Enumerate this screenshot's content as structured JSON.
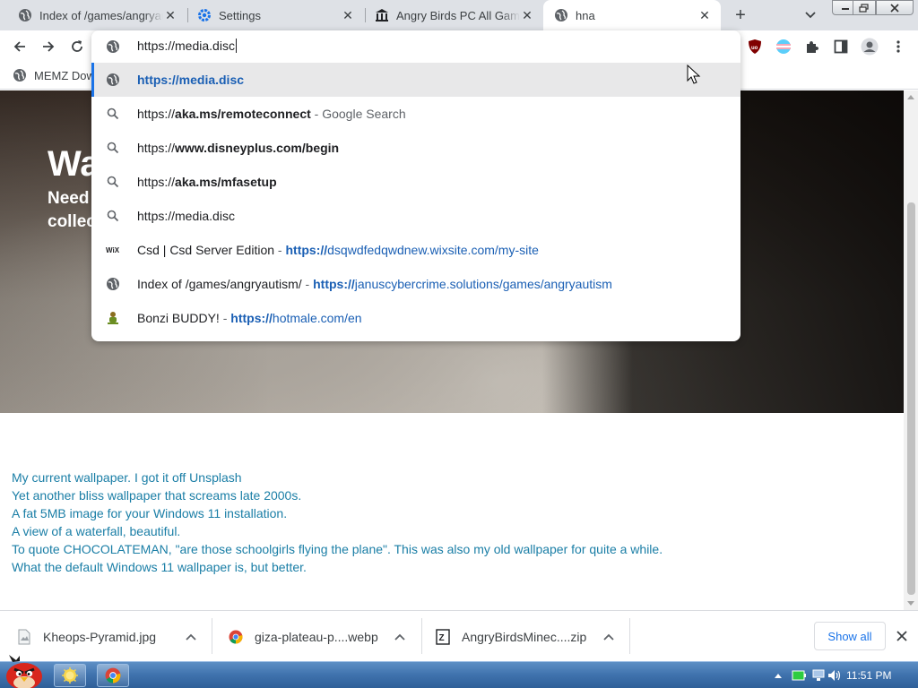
{
  "tabs": [
    {
      "title": "Index of /games/angryautism/",
      "icon": "globe-icon",
      "active": false
    },
    {
      "title": "Settings",
      "icon": "gear-icon",
      "active": false
    },
    {
      "title": "Angry Birds PC All Games",
      "icon": "museum-icon",
      "active": false
    },
    {
      "title": "hna",
      "icon": "globe-icon",
      "active": true
    }
  ],
  "toolbar": {
    "back_icon": "arrow-left-icon",
    "forward_icon": "arrow-right-icon",
    "reload_icon": "reload-icon",
    "extensions": [
      "ublock-origin-icon",
      "trans-flag-icon",
      "puzzle-icon",
      "side-panel-icon",
      "profile-icon",
      "kebab-menu-icon"
    ]
  },
  "omnibox": {
    "input_value": "https://media.disc",
    "suggestions": [
      {
        "icon": "globe-icon",
        "type": "url",
        "text": "https://media.disc",
        "selected": true
      },
      {
        "icon": "search-icon",
        "type": "search",
        "prefix": "https://",
        "bold": "aka.ms/remoteconnect",
        "aux": "Google Search"
      },
      {
        "icon": "search-icon",
        "type": "search",
        "prefix": "https://",
        "bold": "www.disneyplus.com/begin",
        "aux": ""
      },
      {
        "icon": "search-icon",
        "type": "search",
        "prefix": "https://",
        "bold": "aka.ms/mfasetup",
        "aux": ""
      },
      {
        "icon": "search-icon",
        "type": "search",
        "prefix": "https://media.disc",
        "bold": "",
        "aux": ""
      },
      {
        "icon": "wix-icon",
        "type": "history",
        "title": "Csd | Csd Server Edition",
        "url_bold": "https://",
        "url_rest": "dsqwdfedqwdnew.wixsite.com/my-site"
      },
      {
        "icon": "globe-icon",
        "type": "history",
        "title": "Index of /games/angryautism/",
        "url_bold": "https://",
        "url_rest": "januscybercrime.solutions/games/angryautism"
      },
      {
        "icon": "bonzi-icon",
        "type": "history",
        "title": "Bonzi BUDDY!",
        "url_bold": "https://",
        "url_rest": "hotmale.com/en"
      }
    ],
    "separator": "-"
  },
  "bookmarks": [
    {
      "label": "MEMZ Dow",
      "icon": "globe-icon"
    }
  ],
  "page": {
    "hero_title": "Wa",
    "hero_subtitle": "Need collec",
    "captions": [
      "My current wallpaper. I got it off Unsplash",
      "Yet another bliss wallpaper that screams late 2000s.",
      "A fat 5MB image for your Windows 11 installation.",
      "A view of a waterfall, beautiful.",
      "To quote CHOCOLATEMAN, \"are those schoolgirls flying the plane\". This was also my old wallpaper for quite a while.",
      "What the default Windows 11 wallpaper is, but better."
    ]
  },
  "downloads": {
    "items": [
      {
        "name": "Kheops-Pyramid.jpg",
        "icon": "image-file-icon"
      },
      {
        "name": "giza-plateau-p....webp",
        "icon": "chrome-icon"
      },
      {
        "name": "AngryBirdsMinec....zip",
        "icon": "zip-file-icon"
      }
    ],
    "show_all": "Show all"
  },
  "taskbar": {
    "clock": "11:51 PM",
    "start_icon": "angry-bird-icon",
    "pinned": [
      "explorer-icon",
      "chrome-icon"
    ],
    "tray_icons": [
      "tray-up-arrow-icon",
      "battery-icon",
      "network-icon",
      "volume-icon"
    ]
  },
  "colors": {
    "accent": "#1a73e8",
    "link": "#1a5fb4",
    "caption_text": "#1a7ea6",
    "tab_strip": "#dee1e6"
  }
}
